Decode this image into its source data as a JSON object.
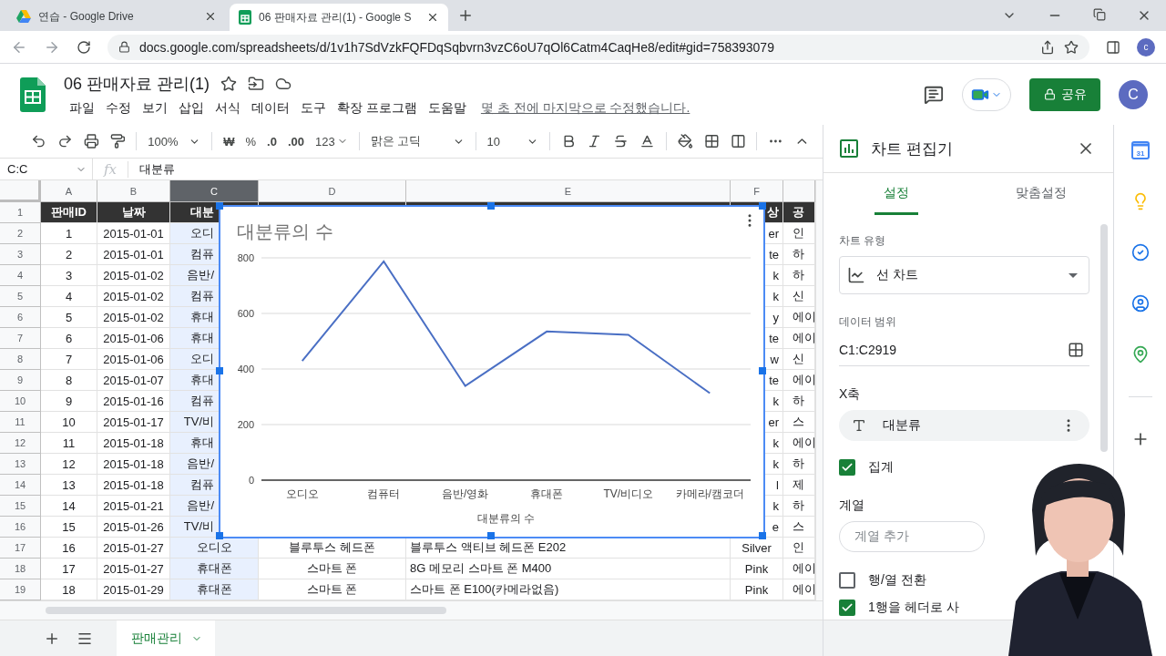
{
  "browser": {
    "tabs": [
      {
        "title": "연습 - Google Drive",
        "selected": false,
        "kind": "drive"
      },
      {
        "title": "06 판매자료 관리(1) - Google S",
        "selected": true,
        "kind": "sheets"
      }
    ],
    "url": "docs.google.com/spreadsheets/d/1v1h7SdVzkFQFDqSqbvrn3vzC6oU7qOl6Catm4CaqHe8/edit#gid=758393079",
    "profile": "c"
  },
  "document": {
    "title": "06 판매자료 관리(1)",
    "menus": [
      "파일",
      "수정",
      "보기",
      "삽입",
      "서식",
      "데이터",
      "도구",
      "확장 프로그램",
      "도움말"
    ],
    "last_edit": "몇 초 전에 마지막으로 수정했습니다.",
    "share": "공유",
    "account": "C"
  },
  "toolbar": {
    "zoom": "100%",
    "currency": "₩",
    "percent": "%",
    "decimal_less": ".0",
    "decimal_more": ".00",
    "number_format": "123",
    "font": "맑은 고딕",
    "font_size": "10"
  },
  "formula_bar": {
    "name_box": "C:C",
    "function_label": "fx",
    "content": "대분류"
  },
  "grid": {
    "columns": [
      {
        "label": "A",
        "selected": false
      },
      {
        "label": "B",
        "selected": false
      },
      {
        "label": "C",
        "selected": true
      },
      {
        "label": "D",
        "selected": false
      },
      {
        "label": "E",
        "selected": false
      },
      {
        "label": "F",
        "selected": false
      }
    ],
    "rows": [
      {
        "number": "1",
        "kind": "header",
        "cells": {
          "A": "판매ID",
          "B": "날짜",
          "C": "대분",
          "F": "상",
          "G": "공"
        }
      },
      {
        "number": "2",
        "kind": "data",
        "cells": {
          "A": "1",
          "B": "2015-01-01",
          "C": "오디",
          "F": "er",
          "G": "인"
        }
      },
      {
        "number": "3",
        "kind": "data",
        "cells": {
          "A": "2",
          "B": "2015-01-01",
          "C": "컴퓨",
          "F": "te",
          "G": "하"
        }
      },
      {
        "number": "4",
        "kind": "data",
        "cells": {
          "A": "3",
          "B": "2015-01-02",
          "C": "음반/",
          "F": "k",
          "G": "하"
        }
      },
      {
        "number": "5",
        "kind": "data",
        "cells": {
          "A": "4",
          "B": "2015-01-02",
          "C": "컴퓨",
          "F": "k",
          "G": "신"
        }
      },
      {
        "number": "6",
        "kind": "data",
        "cells": {
          "A": "5",
          "B": "2015-01-02",
          "C": "휴대",
          "F": "y",
          "G": "에이"
        }
      },
      {
        "number": "7",
        "kind": "data",
        "cells": {
          "A": "6",
          "B": "2015-01-06",
          "C": "휴대",
          "F": "te",
          "G": "에이"
        }
      },
      {
        "number": "8",
        "kind": "data",
        "cells": {
          "A": "7",
          "B": "2015-01-06",
          "C": "오디",
          "F": "w",
          "G": "신"
        }
      },
      {
        "number": "9",
        "kind": "data",
        "cells": {
          "A": "8",
          "B": "2015-01-07",
          "C": "휴대",
          "F": "te",
          "G": "에이"
        }
      },
      {
        "number": "10",
        "kind": "data",
        "cells": {
          "A": "9",
          "B": "2015-01-16",
          "C": "컴퓨",
          "F": "k",
          "G": "하"
        }
      },
      {
        "number": "11",
        "kind": "data",
        "cells": {
          "A": "10",
          "B": "2015-01-17",
          "C": "TV/비",
          "F": "er",
          "G": "스"
        }
      },
      {
        "number": "12",
        "kind": "data",
        "cells": {
          "A": "11",
          "B": "2015-01-18",
          "C": "휴대",
          "F": "k",
          "G": "에이"
        }
      },
      {
        "number": "13",
        "kind": "data",
        "cells": {
          "A": "12",
          "B": "2015-01-18",
          "C": "음반/",
          "F": "k",
          "G": "하"
        }
      },
      {
        "number": "14",
        "kind": "data",
        "cells": {
          "A": "13",
          "B": "2015-01-18",
          "C": "컴퓨",
          "F": "l",
          "G": "제"
        }
      },
      {
        "number": "15",
        "kind": "data",
        "cells": {
          "A": "14",
          "B": "2015-01-21",
          "C": "음반/",
          "F": "k",
          "G": "하"
        }
      },
      {
        "number": "16",
        "kind": "data",
        "cells": {
          "A": "15",
          "B": "2015-01-26",
          "C": "TV/비",
          "F": "e",
          "G": "스"
        }
      },
      {
        "number": "17",
        "kind": "data",
        "cells": {
          "A": "16",
          "B": "2015-01-27",
          "C": "오디오",
          "D": "블루투스 헤드폰",
          "E": "블루투스 액티브 헤드폰 E202",
          "F": "Silver",
          "G": "인"
        }
      },
      {
        "number": "18",
        "kind": "data",
        "cells": {
          "A": "17",
          "B": "2015-01-27",
          "C": "휴대폰",
          "D": "스마트 폰",
          "E": "8G 메모리 스마트 폰 M400",
          "F": "Pink",
          "G": "에이"
        }
      },
      {
        "number": "19",
        "kind": "data",
        "cells": {
          "A": "18",
          "B": "2015-01-29",
          "C": "휴대폰",
          "D": "스마트 폰",
          "E": "스마트 폰 E100(카메라없음)",
          "F": "Pink",
          "G": "에이"
        }
      }
    ],
    "chart": {
      "chart_data": {
        "type": "line",
        "title": "대분류의 수",
        "xlabel": "대분류의 수",
        "categories": [
          "오디오",
          "컴퓨터",
          "음반/영화",
          "휴대폰",
          "TV/비디오",
          "카메라/캠코더"
        ],
        "series": [
          {
            "color": "#4a6fc4",
            "values": [
              429,
              787,
              339,
              535,
              523,
              313
            ]
          }
        ],
        "ylim": [
          0,
          800
        ],
        "yticks": [
          0,
          200,
          400,
          600,
          800
        ],
        "grid": true
      }
    }
  },
  "chart_editor": {
    "title": "차트 편집기",
    "tabs": [
      {
        "label": "설정",
        "selected": true
      },
      {
        "label": "맞춤설정",
        "selected": false
      }
    ],
    "chart_type_label": "차트 유형",
    "chart_type": "선 차트",
    "data_range_label": "데이터 범위",
    "data_range": "C1:C2919",
    "x_axis_label": "X축",
    "x_axis_field": "대분류",
    "options": [
      {
        "label": "집계",
        "checked": true
      }
    ],
    "series_label": "계열",
    "series_placeholder": "계열 추가",
    "switches": [
      {
        "label": "행/열 전환",
        "checked": false
      },
      {
        "label": "1행을 헤더로 사",
        "checked": true
      }
    ]
  },
  "apps": {
    "calendar_day": "31"
  },
  "sheets": [
    {
      "label": "판매관리",
      "selected": true
    }
  ]
}
